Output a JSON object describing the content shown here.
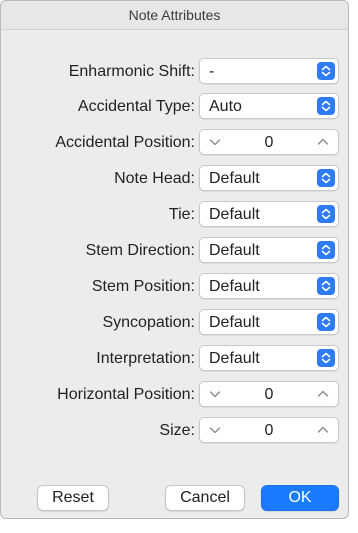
{
  "window": {
    "title": "Note Attributes"
  },
  "fields": [
    {
      "label": "Enharmonic Shift:",
      "type": "popup",
      "value": "-"
    },
    {
      "label": "Accidental Type:",
      "type": "popup",
      "value": "Auto"
    },
    {
      "label": "Accidental Position:",
      "type": "stepper",
      "value": "0"
    },
    {
      "label": "Note Head:",
      "type": "popup",
      "value": "Default"
    },
    {
      "label": "Tie:",
      "type": "popup",
      "value": "Default"
    },
    {
      "label": "Stem Direction:",
      "type": "popup",
      "value": "Default"
    },
    {
      "label": "Stem Position:",
      "type": "popup",
      "value": "Default"
    },
    {
      "label": "Syncopation:",
      "type": "popup",
      "value": "Default"
    },
    {
      "label": "Interpretation:",
      "type": "popup",
      "value": "Default"
    },
    {
      "label": "Horizontal Position:",
      "type": "stepper",
      "value": "0"
    },
    {
      "label": "Size:",
      "type": "stepper",
      "value": "0"
    }
  ],
  "buttons": {
    "reset": "Reset",
    "cancel": "Cancel",
    "ok": "OK"
  },
  "colors": {
    "accent": "#2f7cf6",
    "primary_button": "#1b7bff"
  },
  "icons": {
    "popup": "updown-chevron-icon",
    "stepper_down": "chevron-down-icon",
    "stepper_up": "chevron-up-icon"
  }
}
